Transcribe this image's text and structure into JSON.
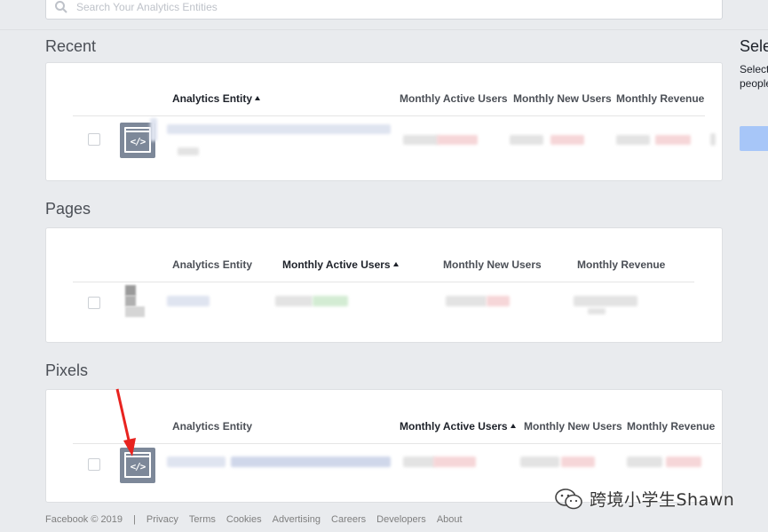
{
  "search": {
    "placeholder": "Search Your Analytics Entities"
  },
  "recent": {
    "title": "Recent",
    "columns": [
      "Analytics Entity",
      "Monthly Active Users",
      "Monthly New Users",
      "Monthly Revenue"
    ],
    "sorted_column": "Analytics Entity"
  },
  "pages": {
    "title": "Pages",
    "columns": [
      "Analytics Entity",
      "Monthly Active Users",
      "Monthly New Users",
      "Monthly Revenue"
    ],
    "sorted_column": "Monthly Active Users"
  },
  "pixels": {
    "title": "Pixels",
    "columns": [
      "Analytics Entity",
      "Monthly Active Users",
      "Monthly New Users",
      "Monthly Revenue"
    ],
    "sorted_column": "Monthly Active Users"
  },
  "right_panel": {
    "title": "Sele",
    "desc_line1": "Select",
    "desc_line2": "people"
  },
  "code_icon_text": "</>",
  "footer": {
    "copyright": "Facebook © 2019",
    "divider": "|",
    "links": [
      "Privacy",
      "Terms",
      "Cookies",
      "Advertising",
      "Careers",
      "Developers",
      "About"
    ]
  },
  "watermark": {
    "text": "跨境小学生Shawn"
  },
  "colors": {
    "accent": "#4267b2",
    "annotation_arrow": "#e8231f",
    "icon_bg": "#7d8899"
  }
}
